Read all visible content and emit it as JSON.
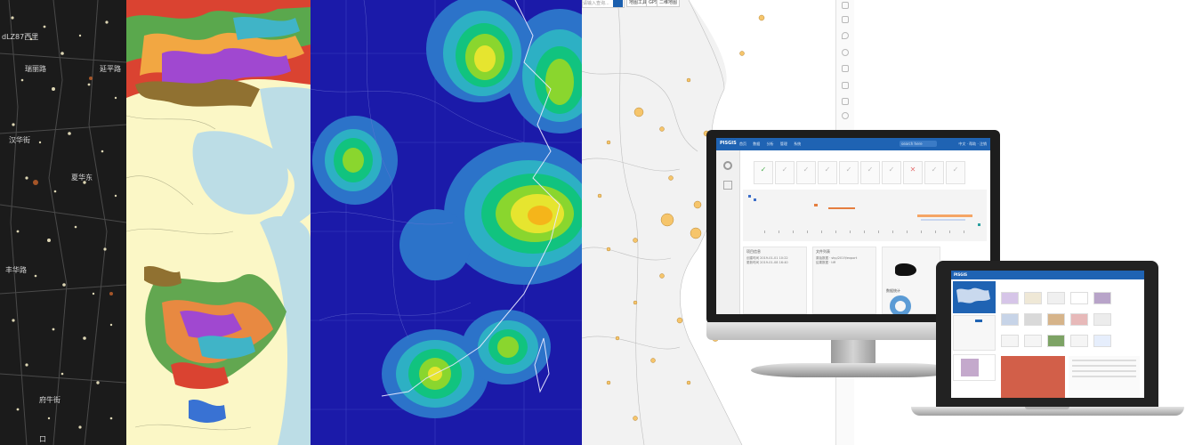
{
  "city_map": {
    "labels": [
      "dLZ87西里",
      "瑞丽路",
      "延平路",
      "汉华街",
      "夏华东",
      "丰华路",
      "府牛街",
      "口"
    ]
  },
  "geo_map": {},
  "heat_map": {
    "colors": [
      "#1b1aa9",
      "#2c73c9",
      "#2db0c4",
      "#11c37f",
      "#8ad62e",
      "#e6e52f",
      "#f5b51a"
    ]
  },
  "point_map": {
    "search_placeholder": "请输入查询...",
    "tabs": [
      "地图工具",
      "GPS",
      "二维地图"
    ],
    "point_color": "#f6c56b"
  },
  "monitor_app": {
    "logo": "PISGIS",
    "nav": [
      "首页",
      "数据",
      "分析",
      "管理",
      "系统"
    ],
    "search": "search here",
    "user": "中文 · 帮助 · 注销",
    "card1_title": "项目信息",
    "card1_lines": [
      "创建时间 2019-01-01 10:22",
      "更新时间 2019-01-08 16:40"
    ],
    "card2_title": "文件列表",
    "card2_lines": [
      "原始数据 · shp/2019/export",
      "结果数据 · tiff"
    ],
    "card3_title": "数据统计"
  },
  "laptop_app": {
    "logo": "PISGIS"
  }
}
